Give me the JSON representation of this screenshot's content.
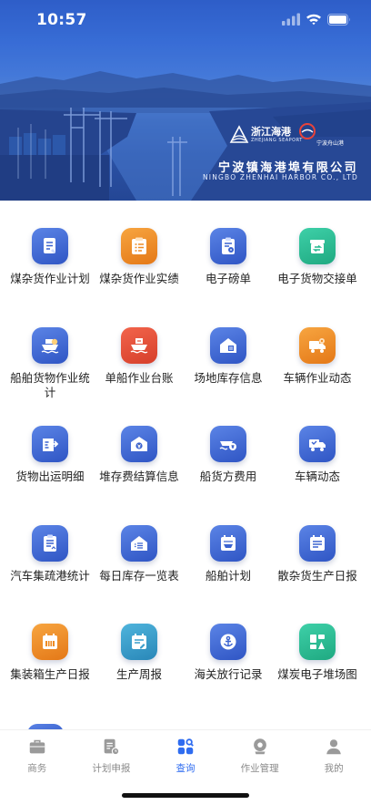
{
  "status_bar": {
    "time": "10:57"
  },
  "banner": {
    "logo_zj_text": "浙江海港",
    "logo_zj_sub": "ZHEJIANG SEAPORT",
    "logo_nb_text": "宁波舟山港",
    "company_cn": "宁波镇海港埠有限公司",
    "company_en": "NINGBO ZHENHAI HARBOR CO., LTD"
  },
  "menu": [
    {
      "label": "煤杂货作业计划",
      "icon": "document-plan-icon",
      "color": "blue"
    },
    {
      "label": "煤杂货作业实绩",
      "icon": "clipboard-list-icon",
      "color": "orange"
    },
    {
      "label": "电子磅单",
      "icon": "receipt-icon",
      "color": "blue"
    },
    {
      "label": "电子货物交接单",
      "icon": "cargo-box-icon",
      "color": "green"
    },
    {
      "label": "船舶货物作业统计",
      "icon": "ship-cargo-icon",
      "color": "blue"
    },
    {
      "label": "单船作业台账",
      "icon": "ship-ledger-icon",
      "color": "red"
    },
    {
      "label": "场地库存信息",
      "icon": "warehouse-icon",
      "color": "blue"
    },
    {
      "label": "车辆作业动态",
      "icon": "truck-gear-icon",
      "color": "orange"
    },
    {
      "label": "货物出运明细",
      "icon": "shipment-detail-icon",
      "color": "blue"
    },
    {
      "label": "堆存费结算信息",
      "icon": "storage-fee-icon",
      "color": "blue"
    },
    {
      "label": "船货方费用",
      "icon": "ship-fee-icon",
      "color": "blue"
    },
    {
      "label": "车辆动态",
      "icon": "truck-icon",
      "color": "blue"
    },
    {
      "label": "汽车集疏港统计",
      "icon": "stats-doc-icon",
      "color": "blue"
    },
    {
      "label": "每日库存一览表",
      "icon": "daily-stock-icon",
      "color": "blue"
    },
    {
      "label": "船舶计划",
      "icon": "ship-plan-icon",
      "color": "blue"
    },
    {
      "label": "散杂货生产日报",
      "icon": "bulk-report-icon",
      "color": "blue"
    },
    {
      "label": "集装箱生产日报",
      "icon": "container-report-icon",
      "color": "orange"
    },
    {
      "label": "生产周报",
      "icon": "weekly-report-icon",
      "color": "teal"
    },
    {
      "label": "海关放行记录",
      "icon": "customs-anchor-icon",
      "color": "blue"
    },
    {
      "label": "煤炭电子堆场图",
      "icon": "yard-map-icon",
      "color": "green"
    }
  ],
  "tabbar": {
    "tabs": [
      {
        "label": "商务",
        "icon": "briefcase-icon",
        "active": false
      },
      {
        "label": "计划申报",
        "icon": "plan-report-icon",
        "active": false
      },
      {
        "label": "查询",
        "icon": "query-icon",
        "active": true
      },
      {
        "label": "作业管理",
        "icon": "operation-icon",
        "active": false
      },
      {
        "label": "我的",
        "icon": "user-icon",
        "active": false
      }
    ]
  },
  "colors": {
    "accent": "#2f6cf0",
    "blue": "#3b63d0",
    "orange": "#ee8c25",
    "green": "#27ba91",
    "red": "#e24f37",
    "teal": "#3a9ecb"
  }
}
